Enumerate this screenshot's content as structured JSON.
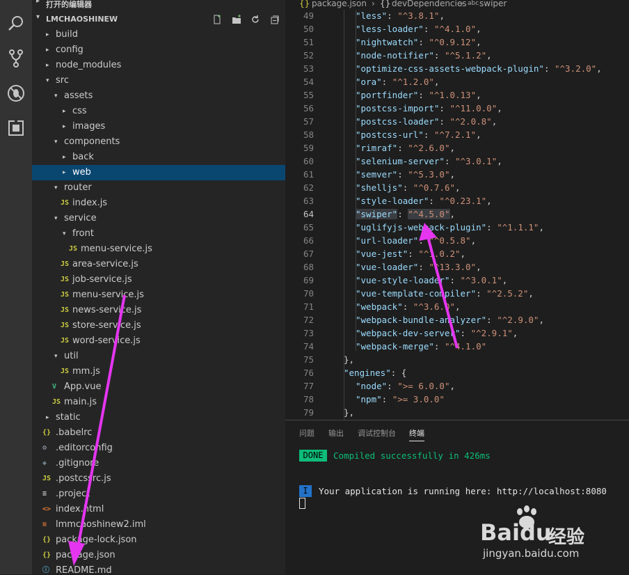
{
  "open_editors_label": "打开的编辑器",
  "explorer": {
    "root_label": "LMCHAOSHINEW",
    "items": [
      {
        "name": "build"
      },
      {
        "name": "config"
      },
      {
        "name": "node_modules"
      },
      {
        "name": "src"
      },
      {
        "name": "assets"
      },
      {
        "name": "css"
      },
      {
        "name": "images"
      },
      {
        "name": "components"
      },
      {
        "name": "back"
      },
      {
        "name": "web"
      },
      {
        "name": "router"
      },
      {
        "name": "index.js"
      },
      {
        "name": "service"
      },
      {
        "name": "front"
      },
      {
        "name": "menu-service.js"
      },
      {
        "name": "area-service.js"
      },
      {
        "name": "job-service.js"
      },
      {
        "name": "menu-service.js"
      },
      {
        "name": "news-service.js"
      },
      {
        "name": "store-service.js"
      },
      {
        "name": "word-service.js"
      },
      {
        "name": "util"
      },
      {
        "name": "mm.js"
      },
      {
        "name": "App.vue"
      },
      {
        "name": "main.js"
      },
      {
        "name": "static"
      },
      {
        "name": ".babelrc"
      },
      {
        "name": ".editorconfig"
      },
      {
        "name": ".gitignore"
      },
      {
        "name": ".postcssrc.js"
      },
      {
        "name": ".project"
      },
      {
        "name": "index.html"
      },
      {
        "name": "lmmcaoshinew2.iml"
      },
      {
        "name": "package-lock.json"
      },
      {
        "name": "package.json"
      },
      {
        "name": "README.md"
      }
    ]
  },
  "breadcrumb": {
    "file": "package.json",
    "section": "devDependencies",
    "item": "swiper",
    "sep": "›",
    "obj_icon": "{}",
    "str_icon": "abc"
  },
  "code_lines": [
    {
      "num": "49",
      "key": "\"less\"",
      "val": "\"^3.8.1\""
    },
    {
      "num": "50",
      "key": "\"less-loader\"",
      "val": "\"^4.1.0\""
    },
    {
      "num": "51",
      "key": "\"nightwatch\"",
      "val": "\"^0.9.12\""
    },
    {
      "num": "52",
      "key": "\"node-notifier\"",
      "val": "\"^5.1.2\""
    },
    {
      "num": "53",
      "key": "\"optimize-css-assets-webpack-plugin\"",
      "val": "\"^3.2.0\""
    },
    {
      "num": "54",
      "key": "\"ora\"",
      "val": "\"^1.2.0\""
    },
    {
      "num": "55",
      "key": "\"portfinder\"",
      "val": "\"^1.0.13\""
    },
    {
      "num": "56",
      "key": "\"postcss-import\"",
      "val": "\"^11.0.0\""
    },
    {
      "num": "57",
      "key": "\"postcss-loader\"",
      "val": "\"^2.0.8\""
    },
    {
      "num": "58",
      "key": "\"postcss-url\"",
      "val": "\"^7.2.1\""
    },
    {
      "num": "59",
      "key": "\"rimraf\"",
      "val": "\"^2.6.0\""
    },
    {
      "num": "60",
      "key": "\"selenium-server\"",
      "val": "\"^3.0.1\""
    },
    {
      "num": "61",
      "key": "\"semver\"",
      "val": "\"^5.3.0\""
    },
    {
      "num": "62",
      "key": "\"shelljs\"",
      "val": "\"^0.7.6\""
    },
    {
      "num": "63",
      "key": "\"style-loader\"",
      "val": "\"^0.23.1\""
    },
    {
      "num": "64",
      "key": "\"swiper\"",
      "val": "\"^4.5.0\""
    },
    {
      "num": "65",
      "key": "\"uglifyjs-webpack-plugin\"",
      "val": "\"^1.1.1\""
    },
    {
      "num": "66",
      "key": "\"url-loader\"",
      "val": "\"^0.5.8\""
    },
    {
      "num": "67",
      "key": "\"vue-jest\"",
      "val": "\"^1.0.2\""
    },
    {
      "num": "68",
      "key": "\"vue-loader\"",
      "val": "\"^13.3.0\""
    },
    {
      "num": "69",
      "key": "\"vue-style-loader\"",
      "val": "\"^3.0.1\""
    },
    {
      "num": "70",
      "key": "\"vue-template-compiler\"",
      "val": "\"^2.5.2\""
    },
    {
      "num": "71",
      "key": "\"webpack\"",
      "val": "\"^3.6.0\""
    },
    {
      "num": "72",
      "key": "\"webpack-bundle-analyzer\"",
      "val": "\"^2.9.0\""
    },
    {
      "num": "73",
      "key": "\"webpack-dev-server\"",
      "val": "\"^2.9.1\""
    },
    {
      "num": "74",
      "key": "\"webpack-merge\"",
      "val": "\"^4.1.0\""
    },
    {
      "num": "75",
      "key": "",
      "val": ""
    },
    {
      "num": "76",
      "key": "\"engines\"",
      "val": ""
    },
    {
      "num": "77",
      "key": "\"node\"",
      "val": "\">= 6.0.0\""
    },
    {
      "num": "78",
      "key": "\"npm\"",
      "val": "\">= 3.0.0\""
    },
    {
      "num": "79",
      "key": "",
      "val": ""
    }
  ],
  "panel": {
    "tabs": [
      "问题",
      "输出",
      "调试控制台",
      "终端"
    ],
    "done_badge": "DONE",
    "compiled_text": "Compiled successfully in 426ms",
    "info_badge": "I",
    "running_text": "Your application is running here: http://localhost:8080"
  },
  "watermark": {
    "brand": "Baidu",
    "brand_cn": "经验",
    "url": "jingyan.baidu.com"
  },
  "colors": {
    "accent_arrow": "#e535f0",
    "done_bg": "#0dbc79",
    "info_bg": "#2472c8",
    "selected_row": "#094771",
    "folder_js": "#cbcb41"
  }
}
